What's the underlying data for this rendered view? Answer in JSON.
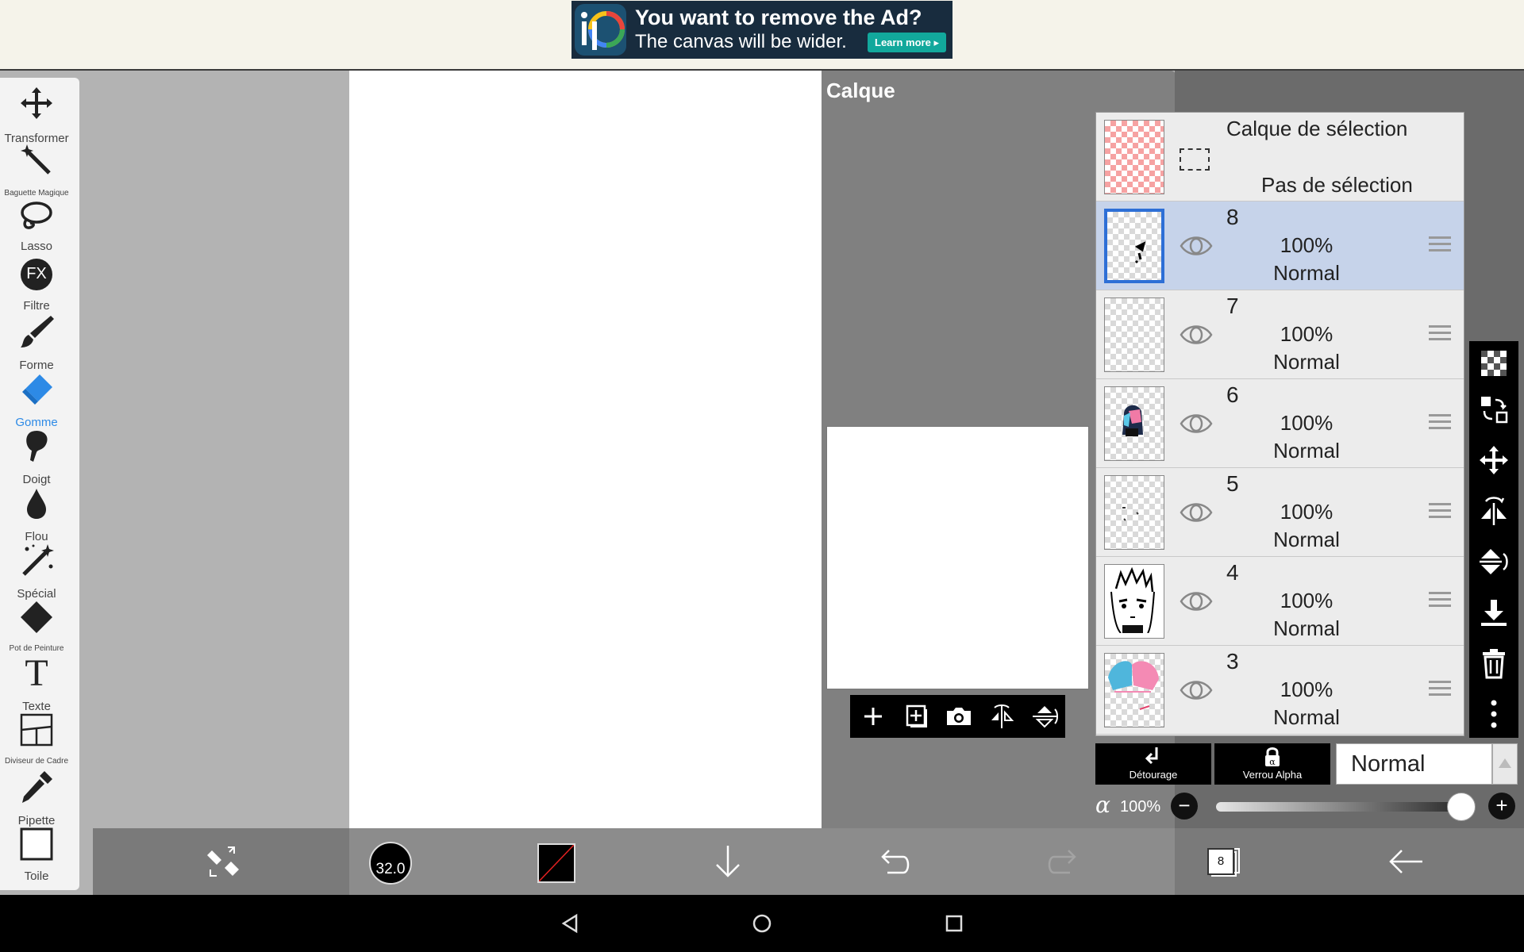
{
  "ad": {
    "headline": "You want to remove the Ad?",
    "subline": "The canvas will be wider.",
    "button": "Learn more"
  },
  "toolbar": {
    "tools": [
      {
        "label": "Transformer",
        "icon": "move-arrows-icon"
      },
      {
        "label": "Baguette Magique",
        "icon": "magic-wand-icon"
      },
      {
        "label": "Lasso",
        "icon": "lasso-icon"
      },
      {
        "label": "Filtre",
        "icon": "fx-filter-icon",
        "glyph": "FX"
      },
      {
        "label": "Forme",
        "icon": "brush-icon"
      },
      {
        "label": "Gomme",
        "icon": "eraser-icon",
        "active": true
      },
      {
        "label": "Doigt",
        "icon": "smudge-finger-icon"
      },
      {
        "label": "Flou",
        "icon": "blur-drop-icon"
      },
      {
        "label": "Spécial",
        "icon": "special-brush-icon"
      },
      {
        "label": "Pot de Peinture",
        "icon": "paint-bucket-icon"
      },
      {
        "label": "Texte",
        "icon": "text-icon",
        "glyph": "T"
      },
      {
        "label": "Diviseur de Cadre",
        "icon": "frame-divider-icon"
      },
      {
        "label": "Pipette",
        "icon": "eyedropper-icon"
      },
      {
        "label": "Toile",
        "icon": "canvas-icon"
      }
    ],
    "active_color": "#2d8ae6"
  },
  "panel": {
    "title": "Calque"
  },
  "layers": {
    "selection_layer": {
      "title": "Calque de sélection",
      "status": "Pas de sélection"
    },
    "items": [
      {
        "number": "8",
        "opacity": "100%",
        "mode": "Normal",
        "selected": true
      },
      {
        "number": "7",
        "opacity": "100%",
        "mode": "Normal",
        "selected": false
      },
      {
        "number": "6",
        "opacity": "100%",
        "mode": "Normal",
        "selected": false
      },
      {
        "number": "5",
        "opacity": "100%",
        "mode": "Normal",
        "selected": false
      },
      {
        "number": "4",
        "opacity": "100%",
        "mode": "Normal",
        "selected": false
      },
      {
        "number": "3",
        "opacity": "100%",
        "mode": "Normal",
        "selected": false
      }
    ]
  },
  "layer_controls": {
    "clipping_label": "Détourage",
    "alpha_lock_label": "Verrou Alpha",
    "blend_mode": "Normal",
    "alpha_symbol": "α",
    "opacity_value": "100%",
    "opacity_fraction": 1.0,
    "minus": "−",
    "plus": "+"
  },
  "bottom_bar": {
    "brush_size": "32.0",
    "current_color": "#000000",
    "layer_count": "8"
  },
  "colors": {
    "selected_layer_bg": "#c6d3ea",
    "selected_layer_border": "#2d6fd6",
    "ad_button": "#12a89c"
  }
}
